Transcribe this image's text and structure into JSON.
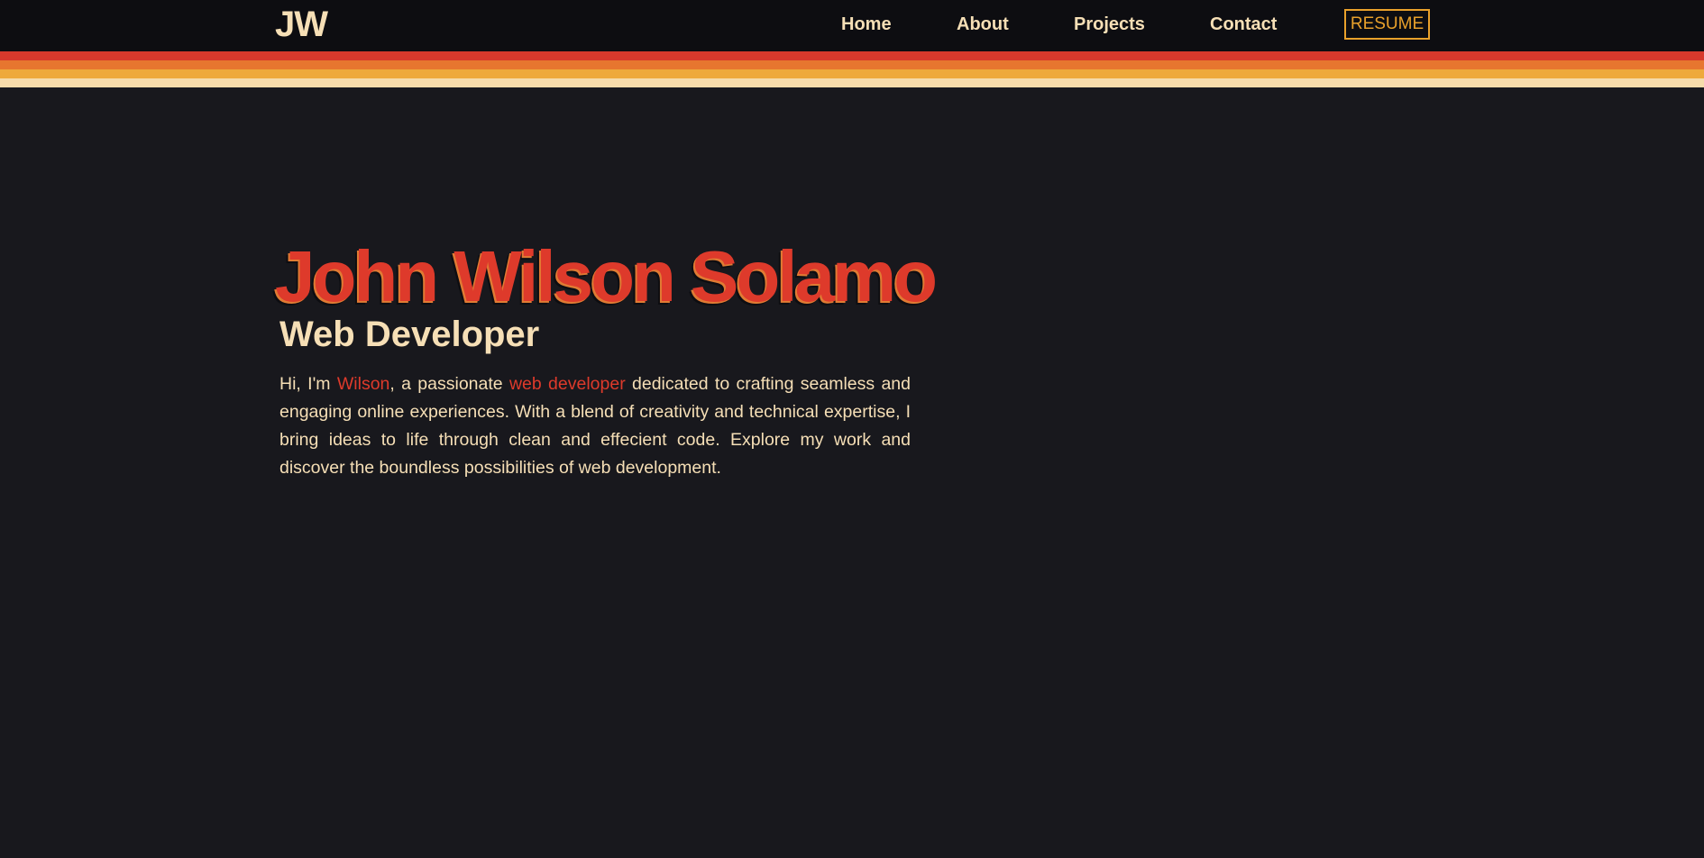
{
  "header": {
    "logo": "JW",
    "nav": [
      "Home",
      "About",
      "Projects",
      "Contact"
    ],
    "resume_label": "RESUME"
  },
  "colors": {
    "background": "#18181d",
    "navbar": "#0d0d11",
    "cream": "#f6dfb6",
    "red": "#de3a2b",
    "orange": "#e07b33",
    "amber": "#e9a12b",
    "stripes": [
      "#d7392c",
      "#e7762f",
      "#eea93b",
      "#f6dbaa"
    ]
  },
  "hero": {
    "name": "John Wilson Solamo",
    "role": "Web Developer",
    "intro": {
      "part1": "Hi, I'm ",
      "highlight1": "Wilson",
      "part2": ", a passionate ",
      "highlight2": "web developer",
      "part3": " dedicated to crafting seamless and engaging online experiences. With a blend of creativity and technical expertise, I bring ideas to life through clean and effecient code. Explore my work and discover the boundless possibilities of web development."
    }
  }
}
